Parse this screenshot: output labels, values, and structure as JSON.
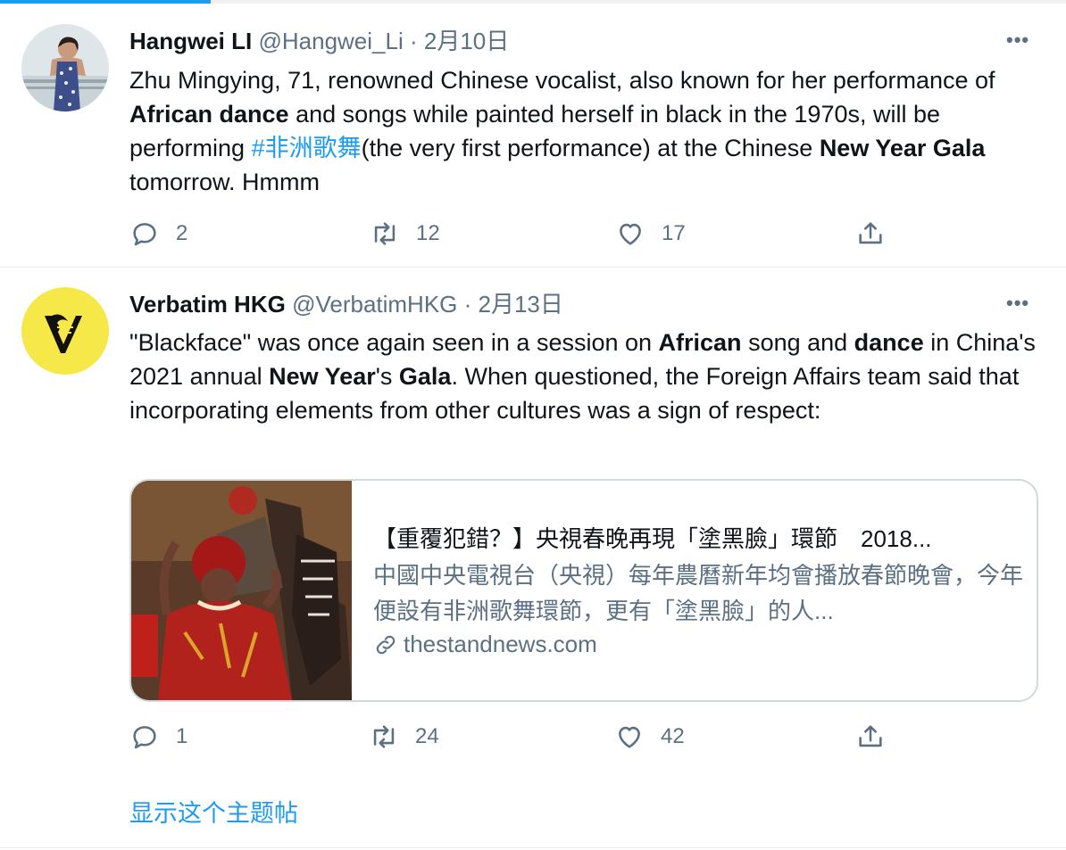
{
  "tweets": [
    {
      "name": "Hangwei LI",
      "handle": "@Hangwei_Li",
      "sep": " · ",
      "date": "2月10日",
      "text": {
        "p1": "Zhu Mingying, 71, renowned Chinese vocalist, also known for her performance of ",
        "b1": "African dance",
        "p2": " and songs while painted herself in black in the 1970s, will be performing ",
        "hashtag": "#非洲歌舞",
        "p3": "(the very first performance) at the Chinese ",
        "b2": "New Year Gala",
        "p4": " tomorrow. Hmmm"
      },
      "reply_count": "2",
      "retweet_count": "12",
      "like_count": "17"
    },
    {
      "name": "Verbatim HKG",
      "handle": "@VerbatimHKG",
      "sep": " · ",
      "date": "2月13日",
      "text": {
        "p1": "\"Blackface\" was once again seen in a session on ",
        "b1": "African",
        "p2": " song and ",
        "b2": "dance",
        "p3": " in China's 2021 annual ",
        "b3": "New Year",
        "p4": "'s ",
        "b4": "Gala",
        "p5": ". When questioned, the Foreign Affairs team said that incorporating elements from other cultures was a sign of respect:"
      },
      "card": {
        "title": "【重覆犯錯？】央視春晚再現「塗黑臉」環節　2018...",
        "description": "中國中央電視台（央視）每年農曆新年均會播放春節晚會，今年便設有非洲歌舞環節，更有「塗黑臉」的人...",
        "domain": "thestandnews.com"
      },
      "reply_count": "1",
      "retweet_count": "24",
      "like_count": "42"
    }
  ],
  "show_thread": "显示这个主题帖",
  "colors": {
    "link": "#1d9bf0",
    "muted": "#5b7083",
    "avatar2_bg": "#f7e84a"
  }
}
